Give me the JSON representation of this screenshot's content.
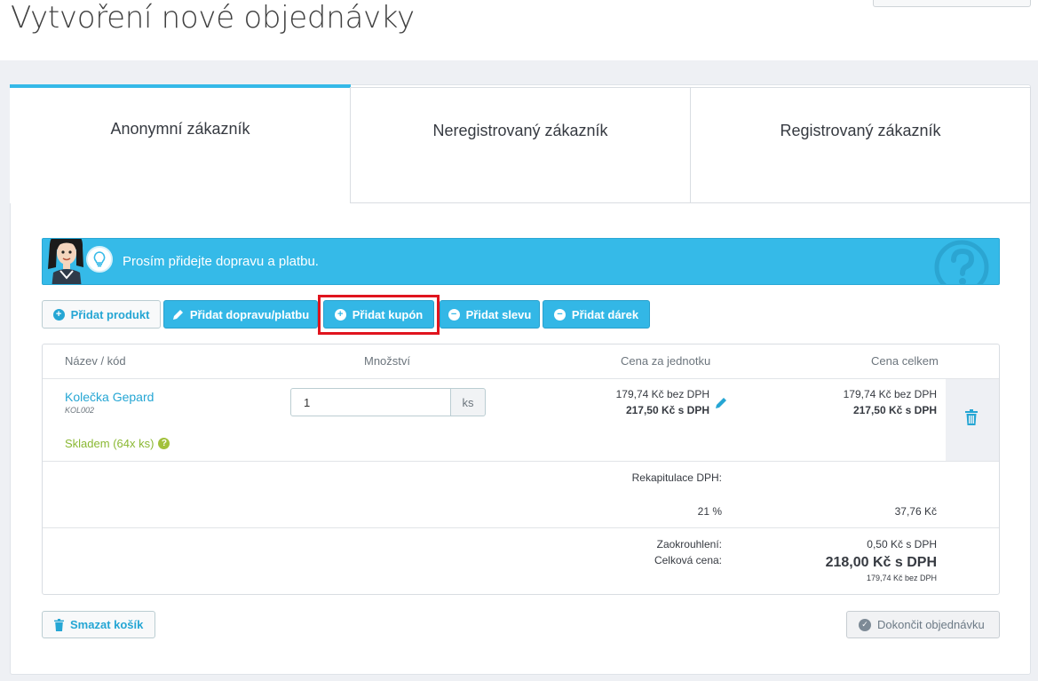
{
  "page": {
    "title": "Vytvoření nové objednávky"
  },
  "tabs": [
    {
      "label": "Anonymní zákazník",
      "active": true
    },
    {
      "label": "Neregistrovaný zákazník",
      "active": false
    },
    {
      "label": "Registrovaný zákazník",
      "active": false
    }
  ],
  "alert": {
    "text": "Prosím přidejte dopravu a platbu."
  },
  "actions": {
    "add_product": "Přidat produkt",
    "add_shipping": "Přidat dopravu/platbu",
    "add_coupon": "Přidat kupón",
    "add_discount": "Přidat slevu",
    "add_gift": "Přidat dárek"
  },
  "cart": {
    "headers": {
      "name": "Název / kód",
      "quantity": "Množství",
      "unit_price": "Cena za jednotku",
      "total_price": "Cena celkem"
    },
    "items": [
      {
        "name": "Kolečka Gepard",
        "code": "KOL002",
        "stock": "Skladem (64x ks)",
        "quantity": "1",
        "unit": "ks",
        "unit_price_net": "179,74 Kč bez DPH",
        "unit_price_gross": "217,50 Kč s DPH",
        "total_net": "179,74 Kč bez DPH",
        "total_gross": "217,50 Kč s DPH"
      }
    ],
    "vat_summary": {
      "label": "Rekapitulace DPH:",
      "rate": "21 %",
      "amount": "37,76 Kč"
    },
    "rounding": {
      "label": "Zaokrouhlení:",
      "value": "0,50 Kč s DPH"
    },
    "total": {
      "label": "Celková cena:",
      "gross": "218,00 Kč s DPH",
      "net": "179,74 Kč bez DPH"
    }
  },
  "footer": {
    "clear_cart": "Smazat košík",
    "finish_order": "Dokončit objednávku"
  },
  "colors": {
    "accent": "#35bae8",
    "highlight": "#e0141e",
    "stock": "#8ab833"
  }
}
